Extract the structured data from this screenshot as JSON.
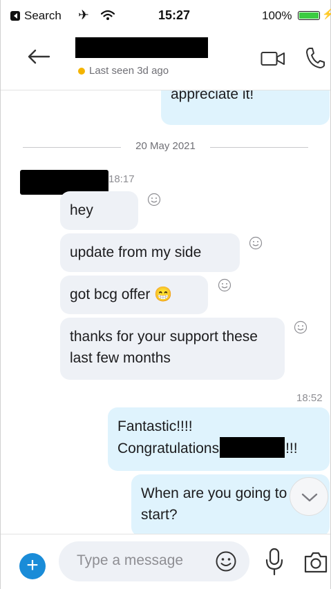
{
  "status_bar": {
    "back_app_label": "Search",
    "time": "15:27",
    "battery_percent": "100%",
    "battery_level": 1.0
  },
  "header": {
    "back_icon": "arrow-left-icon",
    "presence_text": "Last seen 3d ago",
    "presence_color": "#f4b400",
    "video_icon": "video-camera-icon",
    "call_icon": "phone-icon"
  },
  "chat": {
    "earlier_message_tail": "appreciate it!",
    "date_separator": "20 May 2021",
    "incoming_time": "18:17",
    "incoming_messages": [
      {
        "text": "hey"
      },
      {
        "text": "update from my side"
      },
      {
        "text": "got bcg offer",
        "emoji": "😁"
      },
      {
        "text": "thanks for your support these last few months"
      }
    ],
    "outgoing_time": "18:52",
    "outgoing_messages": [
      {
        "line1": "Fantastic!!!!",
        "line2_prefix": "Congratulations",
        "line2_suffix": "!!!"
      },
      {
        "text": "When are you going to start?"
      }
    ]
  },
  "composer": {
    "placeholder": "Type a message",
    "accent_color": "#1a8cd8"
  },
  "colors": {
    "incoming_bubble": "#eef1f6",
    "outgoing_bubble": "#dff3fd"
  }
}
